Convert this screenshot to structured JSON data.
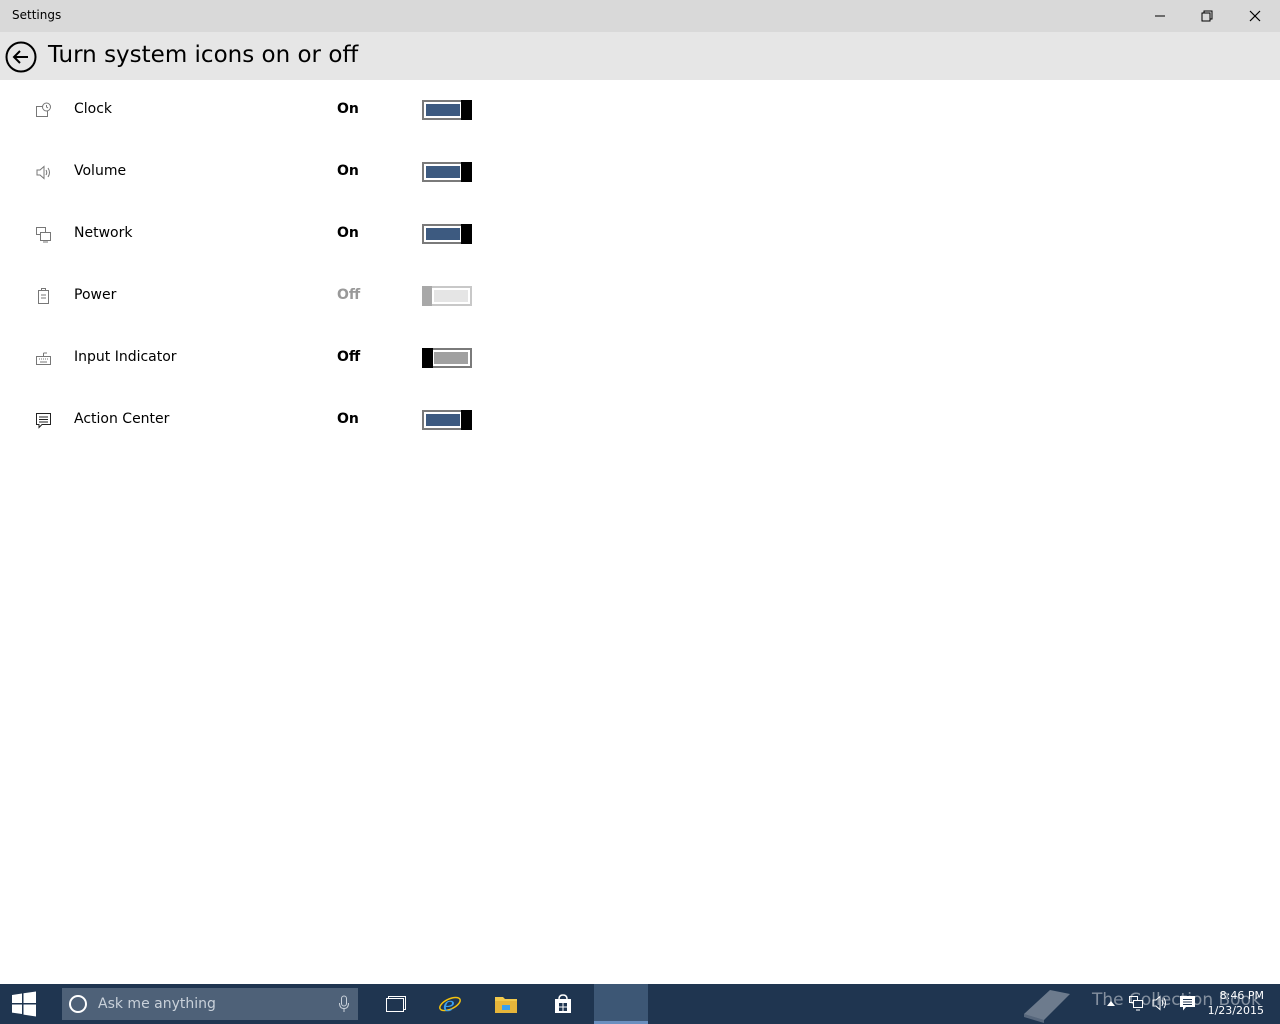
{
  "window": {
    "app_title": "Settings"
  },
  "header": {
    "title": "Turn system icons on or off"
  },
  "settings": [
    {
      "label": "Clock",
      "state": "On",
      "icon": "clock-icon"
    },
    {
      "label": "Volume",
      "state": "On",
      "icon": "volume-icon"
    },
    {
      "label": "Network",
      "state": "On",
      "icon": "network-icon"
    },
    {
      "label": "Power",
      "state": "Off",
      "icon": "power-icon"
    },
    {
      "label": "Input Indicator",
      "state": "Off",
      "icon": "keyboard-icon"
    },
    {
      "label": "Action Center",
      "state": "On",
      "icon": "action-center-icon"
    }
  ],
  "taskbar": {
    "search_placeholder": "Ask me anything",
    "watermark": "The Collection Book",
    "time": "8:46 PM",
    "date": "1/23/2015"
  },
  "colors": {
    "accent": "#3d5a80",
    "taskbar": "#1f3550",
    "header": "#e6e6e6",
    "titlebar": "#d9d9d9"
  }
}
